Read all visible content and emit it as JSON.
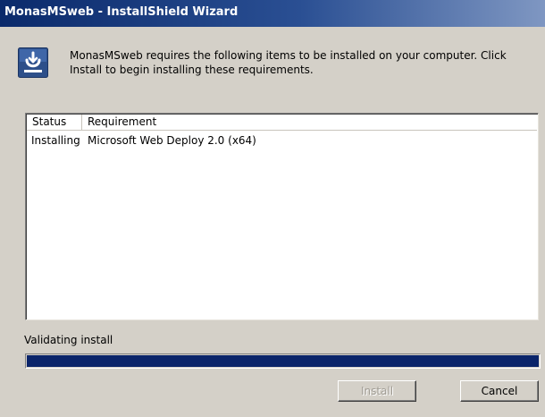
{
  "window": {
    "title": "MonasMSweb - InstallShield Wizard"
  },
  "intro": {
    "icon": "setup-icon",
    "message": "MonasMSweb requires the following items to be installed on your computer. Click Install to begin installing these requirements."
  },
  "requirements_list": {
    "columns": [
      "Status",
      "Requirement"
    ],
    "rows": [
      {
        "status": "Installing",
        "requirement": "Microsoft Web Deploy 2.0 (x64)"
      }
    ]
  },
  "progress": {
    "status_text": "Validating install",
    "fraction": 1.0,
    "color": "#0a246a"
  },
  "buttons": {
    "install_label": "Install",
    "install_enabled": false,
    "cancel_label": "Cancel"
  },
  "colors": {
    "dialog_bg": "#d4d0c8",
    "titlebar_start": "#0b2a6b",
    "titlebar_end": "#7f97c2"
  }
}
